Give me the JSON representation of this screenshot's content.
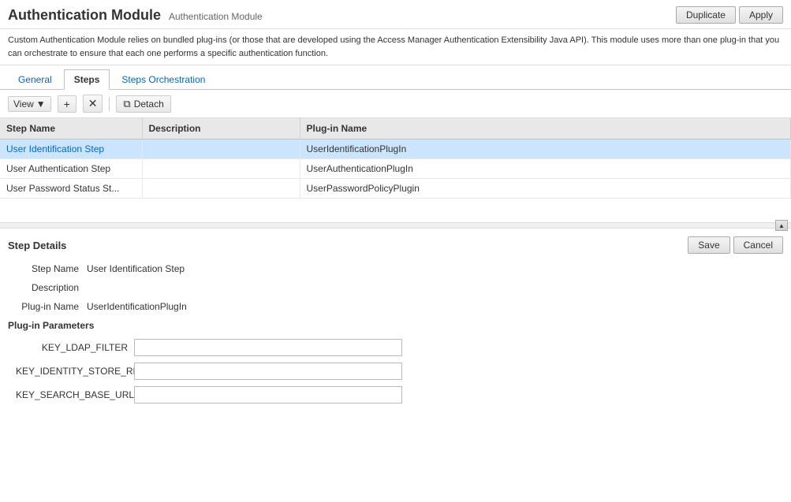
{
  "header": {
    "title": "Authentication Module",
    "subtitle": "Authentication Module",
    "buttons": {
      "duplicate": "Duplicate",
      "apply": "Apply"
    }
  },
  "description": "Custom Authentication Module relies on bundled plug-ins (or those that are developed using the Access Manager Authentication Extensibility Java API). This module uses more than one plug-in that you can orchestrate to ensure that each one performs a specific authentication function.",
  "tabs": [
    {
      "label": "General",
      "active": false
    },
    {
      "label": "Steps",
      "active": true
    },
    {
      "label": "Steps Orchestration",
      "active": false
    }
  ],
  "toolbar": {
    "view_label": "View",
    "detach_label": "Detach"
  },
  "table": {
    "columns": [
      "Step Name",
      "Description",
      "Plug-in Name"
    ],
    "rows": [
      {
        "step_name": "User Identification Step",
        "description": "",
        "plugin_name": "UserIdentificationPlugIn",
        "selected": true
      },
      {
        "step_name": "User Authentication Step",
        "description": "",
        "plugin_name": "UserAuthenticationPlugIn",
        "selected": false
      },
      {
        "step_name": "User Password Status St...",
        "description": "",
        "plugin_name": "UserPasswordPolicyPlugin",
        "selected": false
      }
    ]
  },
  "step_details": {
    "title": "Step Details",
    "save_label": "Save",
    "cancel_label": "Cancel",
    "fields": {
      "step_name_label": "Step Name",
      "step_name_value": "User Identification Step",
      "description_label": "Description",
      "description_value": "",
      "plugin_name_label": "Plug-in Name",
      "plugin_name_value": "UserIdentificationPlugIn"
    },
    "plugin_params_title": "Plug-in Parameters",
    "params": [
      {
        "label": "KEY_LDAP_FILTER",
        "value": ""
      },
      {
        "label": "KEY_IDENTITY_STORE_REF",
        "value": ""
      },
      {
        "label": "KEY_SEARCH_BASE_URL",
        "value": ""
      }
    ]
  }
}
